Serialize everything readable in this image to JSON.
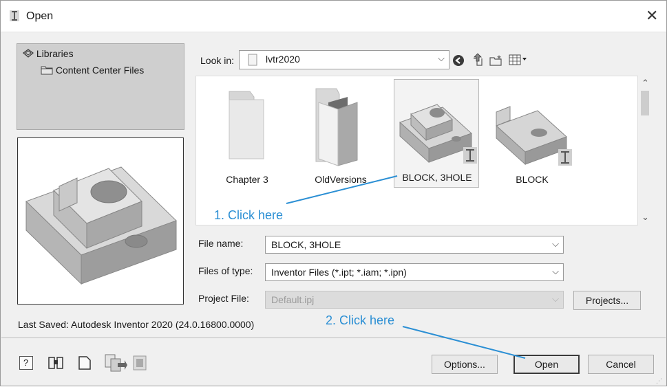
{
  "window": {
    "title": "Open",
    "close_glyph": "✕"
  },
  "places": {
    "items": [
      {
        "label": "Libraries",
        "icon": "libraries-icon"
      },
      {
        "label": "Content Center Files",
        "icon": "folder-icon"
      }
    ]
  },
  "look_in": {
    "label": "Look in:",
    "value": "lvtr2020"
  },
  "files": [
    {
      "name": "Chapter 3",
      "type": "folder"
    },
    {
      "name": "OldVersions",
      "type": "folder"
    },
    {
      "name": "BLOCK, 3HOLE",
      "type": "part",
      "selected": true
    },
    {
      "name": "BLOCK",
      "type": "part"
    }
  ],
  "file_name": {
    "label": "File name:",
    "value": "BLOCK, 3HOLE"
  },
  "files_of_type": {
    "label": "Files of type:",
    "value": "Inventor Files (*.ipt; *.iam; *.ipn)"
  },
  "project_file": {
    "label": "Project File:",
    "value": "Default.ipj",
    "disabled": true
  },
  "buttons": {
    "projects": "Projects...",
    "options": "Options...",
    "open": "Open",
    "cancel": "Cancel"
  },
  "status": {
    "last_saved": "Last Saved: Autodesk Inventor 2020 (24.0.16800.0000)"
  },
  "annotations": {
    "click1": "1. Click here",
    "click2": "2. Click here"
  },
  "colors": {
    "annotation": "#2b8fd4",
    "window_bg": "#f0f0f0",
    "places_bg": "#cfcfcf"
  }
}
